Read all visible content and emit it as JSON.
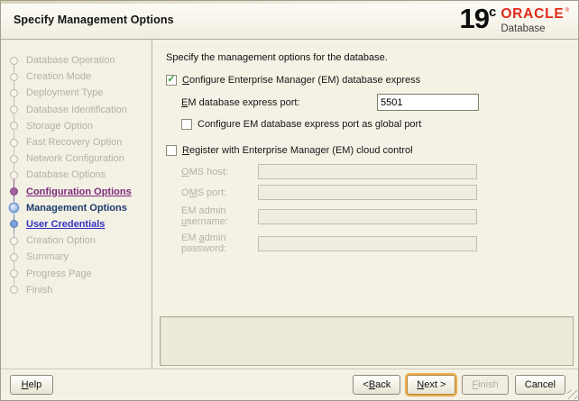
{
  "header": {
    "title": "Specify Management Options",
    "logo": {
      "version": "19",
      "edition": "c",
      "brand": "ORACLE",
      "mark": "®",
      "product": "Database"
    }
  },
  "sidebar": {
    "items": [
      {
        "label": "Database Operation",
        "state": "disabled"
      },
      {
        "label": "Creation Mode",
        "state": "disabled"
      },
      {
        "label": "Deployment Type",
        "state": "disabled"
      },
      {
        "label": "Database Identification",
        "state": "disabled"
      },
      {
        "label": "Storage Option",
        "state": "disabled"
      },
      {
        "label": "Fast Recovery Option",
        "state": "disabled"
      },
      {
        "label": "Network Configuration",
        "state": "disabled"
      },
      {
        "label": "Database Options",
        "state": "disabled"
      },
      {
        "label": "Configuration Options",
        "state": "visited-link"
      },
      {
        "label": "Management Options",
        "state": "current"
      },
      {
        "label": "User Credentials",
        "state": "link"
      },
      {
        "label": "Creation Option",
        "state": "disabled"
      },
      {
        "label": "Summary",
        "state": "disabled"
      },
      {
        "label": "Progress Page",
        "state": "disabled"
      },
      {
        "label": "Finish",
        "state": "disabled"
      }
    ]
  },
  "content": {
    "description": "Specify the management options for the database.",
    "em_express_checkbox": {
      "checked": true,
      "check_glyph": "✓",
      "label_pre": "",
      "label_key": "C",
      "label_post": "onfigure Enterprise Manager (EM) database express"
    },
    "port_field": {
      "label_pre": "",
      "label_key": "E",
      "label_post": "M database express port:",
      "value": "5501"
    },
    "global_port_checkbox": {
      "checked": false,
      "check_glyph": "",
      "label_pre": "Configure EM database express port as ",
      "label_key": "g",
      "label_post": "lobal port"
    },
    "cloud_control_checkbox": {
      "checked": false,
      "check_glyph": "",
      "label_pre": "",
      "label_key": "R",
      "label_post": "egister with Enterprise Manager (EM) cloud control"
    },
    "oms_host_field": {
      "label_pre": "",
      "label_key": "O",
      "label_post": "MS host:",
      "value": ""
    },
    "oms_port_field": {
      "label_pre": "O",
      "label_key": "M",
      "label_post": "S port:",
      "value": ""
    },
    "em_admin_username_field": {
      "label_pre": "EM admin ",
      "label_key": "u",
      "label_post": "sername:",
      "value": ""
    },
    "em_admin_password_field": {
      "label_pre": "EM ",
      "label_key": "a",
      "label_post": "dmin password:",
      "value": ""
    }
  },
  "footer": {
    "help_button": {
      "pre": "",
      "key": "H",
      "post": "elp"
    },
    "back_button": {
      "pre": "< ",
      "key": "B",
      "post": "ack"
    },
    "next_button": {
      "pre": "",
      "key": "N",
      "post": "ext >"
    },
    "finish_button": {
      "pre": "",
      "key": "F",
      "post": "inish"
    },
    "cancel_button": {
      "pre": "Cancel",
      "key": "",
      "post": ""
    }
  }
}
